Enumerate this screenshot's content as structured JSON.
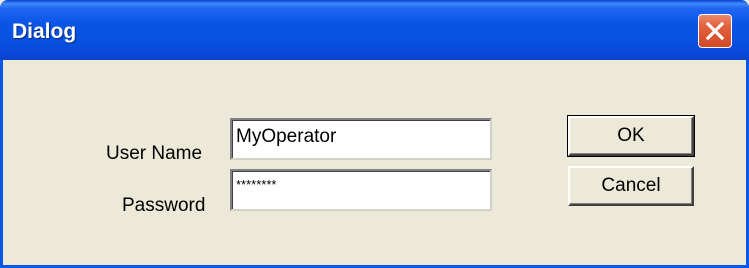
{
  "window": {
    "title": "Dialog"
  },
  "titlebar": {
    "close_icon": "close-icon"
  },
  "form": {
    "username_label": "User Name",
    "username_value": "MyOperator",
    "password_label": "Password",
    "password_value": "********"
  },
  "buttons": {
    "ok_label": "OK",
    "cancel_label": "Cancel"
  },
  "colors": {
    "titlebar": "#0850e0",
    "close": "#d14a26",
    "background": "#ece9d8"
  }
}
